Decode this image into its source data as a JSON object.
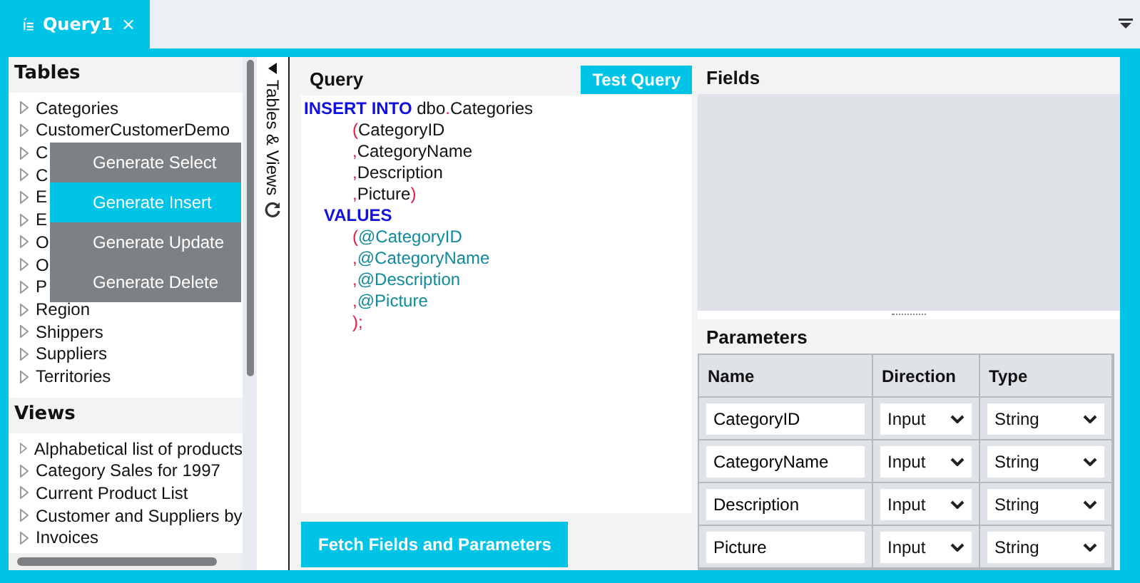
{
  "tab": {
    "title": "Query1",
    "close": "×",
    "selected": true
  },
  "tables": {
    "title": "Tables",
    "items": [
      "Categories",
      "CustomerCustomerDemo",
      "C",
      "C",
      "E",
      "E",
      "O",
      "O",
      "P",
      "Region",
      "Shippers",
      "Suppliers",
      "Territories"
    ]
  },
  "views": {
    "title": "Views",
    "items": [
      "Alphabetical list of products",
      "Category Sales for 1997",
      "Current Product List",
      "Customer and Suppliers by",
      "Invoices"
    ]
  },
  "context_menu": [
    {
      "label": "Generate Select",
      "selected": false
    },
    {
      "label": "Generate Insert",
      "selected": true
    },
    {
      "label": "Generate Update",
      "selected": false
    },
    {
      "label": "Generate Delete",
      "selected": false
    }
  ],
  "side_strip": {
    "label": "Tables & Views"
  },
  "query": {
    "title": "Query",
    "test_button": "Test Query",
    "fetch_button": "Fetch Fields and Parameters",
    "lines": [
      [
        {
          "kind": "keyword",
          "text": "INSERT INTO "
        },
        {
          "kind": "plain",
          "text": "dbo"
        },
        {
          "kind": "punct",
          "text": "."
        },
        {
          "kind": "plain",
          "text": "Categories"
        }
      ],
      [
        {
          "kind": "indent2"
        },
        {
          "kind": "punct",
          "text": "("
        },
        {
          "kind": "plain",
          "text": "CategoryID"
        }
      ],
      [
        {
          "kind": "indent2"
        },
        {
          "kind": "punct",
          "text": ","
        },
        {
          "kind": "plain",
          "text": "CategoryName"
        }
      ],
      [
        {
          "kind": "indent2"
        },
        {
          "kind": "punct",
          "text": ","
        },
        {
          "kind": "plain",
          "text": "Description"
        }
      ],
      [
        {
          "kind": "indent2"
        },
        {
          "kind": "punct",
          "text": ","
        },
        {
          "kind": "plain",
          "text": "Picture"
        },
        {
          "kind": "punct",
          "text": ")"
        }
      ],
      [
        {
          "kind": "indent1"
        },
        {
          "kind": "keyword",
          "text": "VALUES"
        }
      ],
      [
        {
          "kind": "indent2"
        },
        {
          "kind": "punct",
          "text": "("
        },
        {
          "kind": "param",
          "text": "@CategoryID"
        }
      ],
      [
        {
          "kind": "indent2"
        },
        {
          "kind": "punct",
          "text": ","
        },
        {
          "kind": "param",
          "text": "@CategoryName"
        }
      ],
      [
        {
          "kind": "indent2"
        },
        {
          "kind": "punct",
          "text": ","
        },
        {
          "kind": "param",
          "text": "@Description"
        }
      ],
      [
        {
          "kind": "indent2"
        },
        {
          "kind": "punct",
          "text": ","
        },
        {
          "kind": "param",
          "text": "@Picture"
        }
      ],
      [
        {
          "kind": "indent2"
        },
        {
          "kind": "punct",
          "text": ");"
        }
      ]
    ]
  },
  "fields": {
    "title": "Fields"
  },
  "parameters": {
    "title": "Parameters",
    "columns": [
      "Name",
      "Direction",
      "Type"
    ],
    "rows": [
      {
        "name": "CategoryID",
        "direction": "Input",
        "type": "String"
      },
      {
        "name": "CategoryName",
        "direction": "Input",
        "type": "String"
      },
      {
        "name": "Description",
        "direction": "Input",
        "type": "String"
      },
      {
        "name": "Picture",
        "direction": "Input",
        "type": "String"
      }
    ]
  }
}
